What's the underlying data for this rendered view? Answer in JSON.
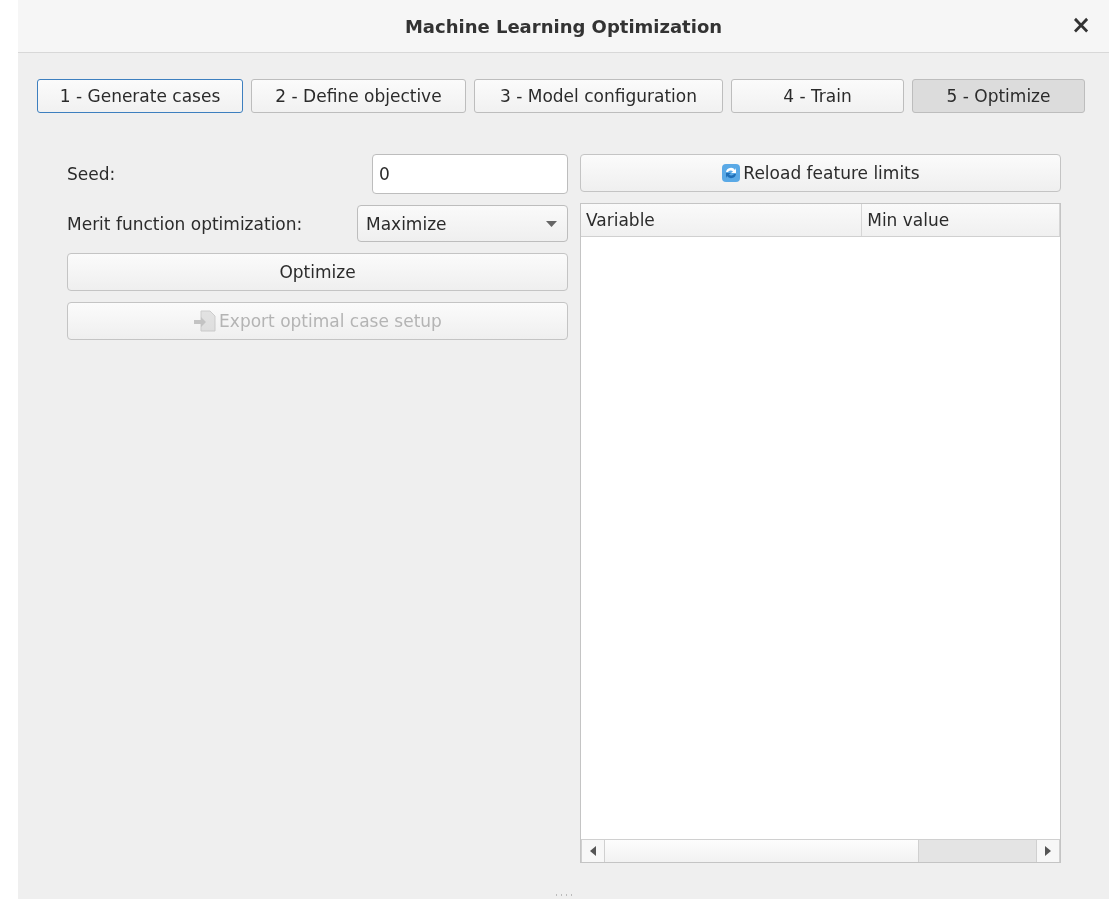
{
  "window": {
    "title": "Machine Learning Optimization",
    "close": "×"
  },
  "tabs": [
    {
      "label": "1 - Generate cases",
      "selected": false,
      "focused": true
    },
    {
      "label": "2 - Define objective",
      "selected": false,
      "focused": false
    },
    {
      "label": "3 - Model configuration",
      "selected": false,
      "focused": false
    },
    {
      "label": "4 - Train",
      "selected": false,
      "focused": false
    },
    {
      "label": "5 - Optimize",
      "selected": true,
      "focused": false
    }
  ],
  "seed": {
    "label": "Seed:",
    "value": "0"
  },
  "merit": {
    "label": "Merit function optimization:",
    "value": "Maximize"
  },
  "optimize_button": {
    "label": "Optimize",
    "disabled": false
  },
  "export_button": {
    "label": "Export optimal case setup",
    "disabled": true
  },
  "reload_button": {
    "label": "Reload feature limits",
    "disabled": false
  },
  "table": {
    "columns": [
      "Variable",
      "Min value"
    ]
  }
}
